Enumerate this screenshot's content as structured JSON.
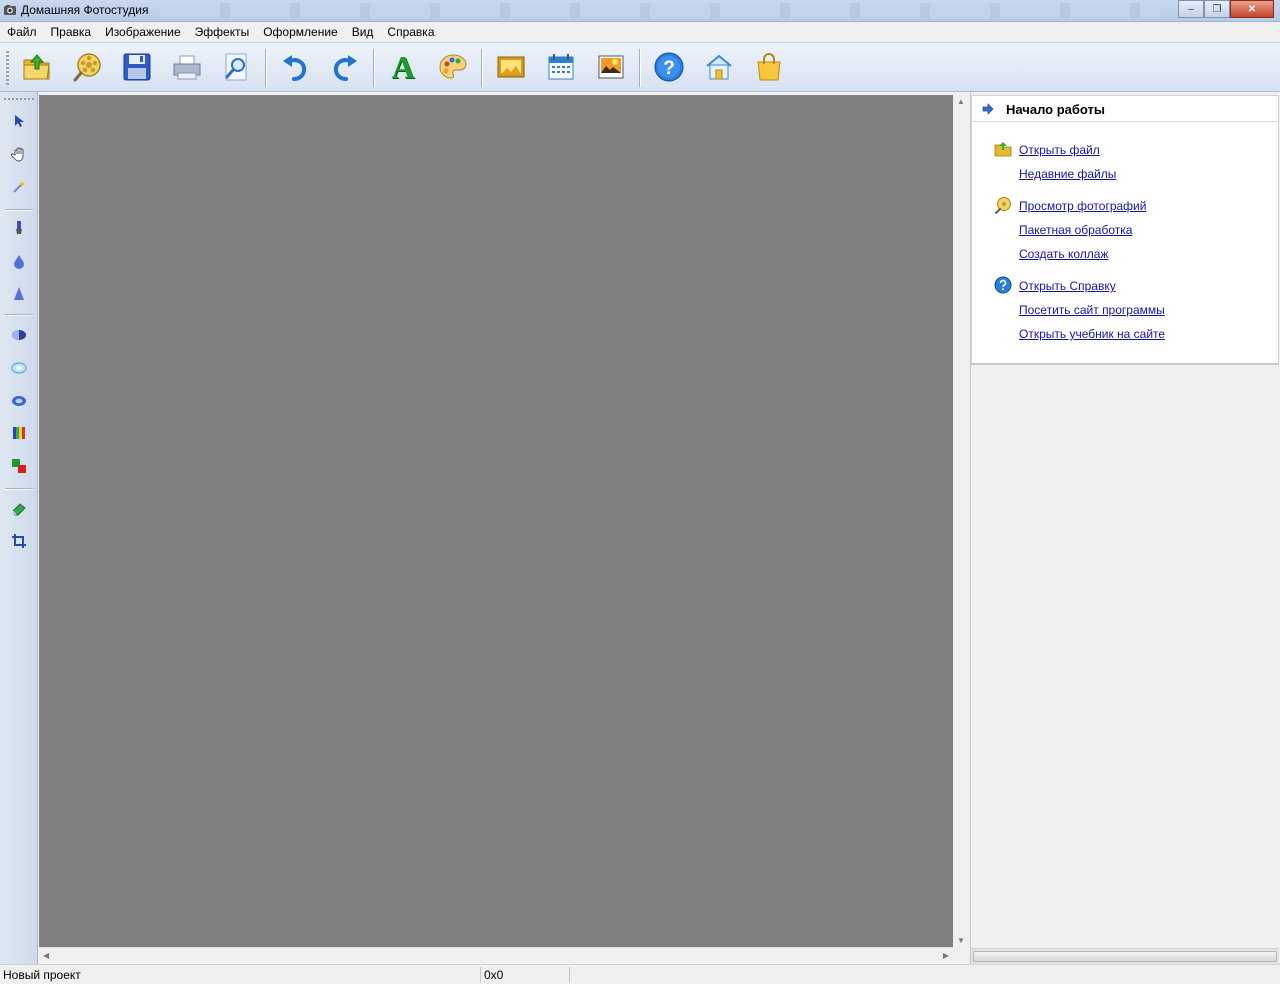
{
  "window": {
    "title": "Домашняя Фотостудия",
    "controls": {
      "minimize": "–",
      "restore": "❐",
      "close": "✕"
    }
  },
  "menu": [
    "Файл",
    "Правка",
    "Изображение",
    "Эффекты",
    "Оформление",
    "Вид",
    "Справка"
  ],
  "toolbar": {
    "icons": [
      "open-folder-icon",
      "photo-viewer-icon",
      "save-icon",
      "print-icon",
      "zoom-icon",
      "undo-icon",
      "redo-icon",
      "text-icon",
      "palette-icon",
      "frame-icon",
      "calendar-icon",
      "postcard-icon",
      "help-icon",
      "website-icon",
      "buy-icon"
    ],
    "text_glyph": "A",
    "help_glyph": "?"
  },
  "tools": [
    "pointer-icon",
    "hand-icon",
    "magic-wand-icon",
    "brush-icon",
    "drop-icon",
    "sharpen-icon",
    "contrast-icon",
    "blur-icon",
    "lens-icon",
    "color-bars-icon",
    "color-replace-icon",
    "eraser-icon",
    "crop-icon"
  ],
  "panel": {
    "title": "Начало работы",
    "links": [
      "Открыть файл",
      "Недавние файлы",
      "Просмотр фотографий",
      "Пакетная обработка",
      "Создать коллаж",
      "Открыть Справку",
      "Посетить сайт программы",
      "Открыть учебник на сайте"
    ]
  },
  "status": {
    "project": "Новый проект",
    "size": "0x0"
  },
  "colors": {
    "canvas": "#808080",
    "link": "#1515a8",
    "toolbar_blue": "#1e74d0"
  }
}
